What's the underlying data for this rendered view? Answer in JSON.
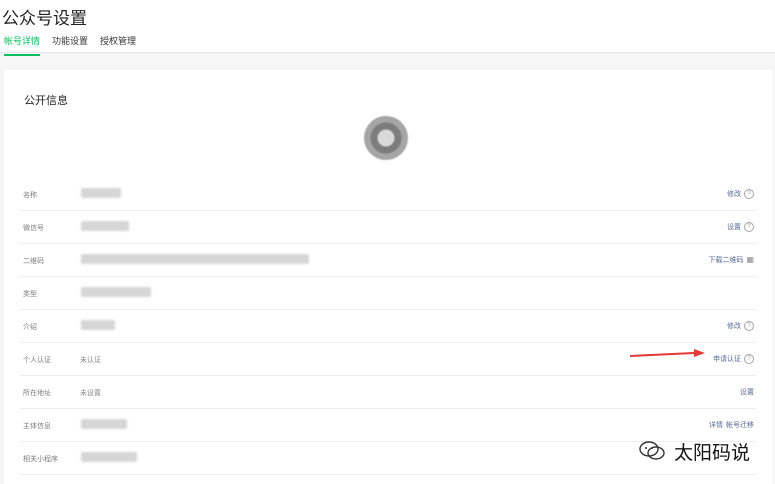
{
  "header": {
    "title": "公众号设置",
    "tabs": [
      {
        "label": "帐号详情",
        "active": true
      },
      {
        "label": "功能设置",
        "active": false
      },
      {
        "label": "授权管理",
        "active": false
      }
    ]
  },
  "section": {
    "title": "公开信息"
  },
  "rows": [
    {
      "label": "名称",
      "value": "",
      "actions": [
        "修改"
      ],
      "help": true
    },
    {
      "label": "微信号",
      "value": "",
      "actions": [
        "设置"
      ],
      "help": true
    },
    {
      "label": "二维码",
      "value": "",
      "actions": [
        "下载二维码"
      ],
      "qr": true
    },
    {
      "label": "类型",
      "value": "",
      "actions": []
    },
    {
      "label": "介绍",
      "value": "",
      "actions": [
        "修改"
      ],
      "help": true
    },
    {
      "label": "个人认证",
      "value": "未认证",
      "actions": [
        "申请认证"
      ],
      "help": true
    },
    {
      "label": "所在地址",
      "value": "未设置",
      "actions": [
        "设置"
      ]
    },
    {
      "label": "主体信息",
      "value": "",
      "actions": [
        "详情",
        "帐号迁移"
      ]
    },
    {
      "label": "相关小程序",
      "value": "",
      "actions": []
    }
  ],
  "watermark": {
    "text": "太阳码说"
  },
  "colors": {
    "accent": "#07c160",
    "link": "#576b95",
    "arrow": "#e53935"
  }
}
